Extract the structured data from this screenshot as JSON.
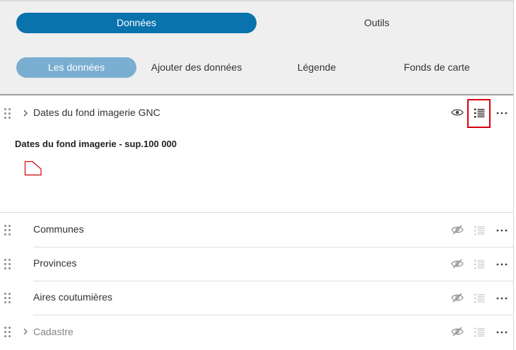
{
  "main_tabs": [
    {
      "label": "Données",
      "active": true
    },
    {
      "label": "Outils",
      "active": false
    }
  ],
  "sub_tabs": [
    {
      "label": "Les données",
      "active": true
    },
    {
      "label": "Ajouter des données",
      "active": false
    },
    {
      "label": "Légende",
      "active": false
    },
    {
      "label": "Fonds de carte",
      "active": false
    }
  ],
  "layers": [
    {
      "title": "Dates du fond imagerie GNC",
      "expandable": true,
      "visible": true,
      "legend_open": true,
      "legend": {
        "title": "Dates du fond imagerie - sup.100 000",
        "symbol_icon": "polygon-outline-icon",
        "symbol_color": "#d4000f"
      }
    },
    {
      "title": "Communes",
      "expandable": false,
      "visible": false
    },
    {
      "title": "Provinces",
      "expandable": false,
      "visible": false
    },
    {
      "title": "Aires coutumières",
      "expandable": false,
      "visible": false
    },
    {
      "title": "Cadastre",
      "expandable": true,
      "visible": false,
      "muted": true
    }
  ],
  "icons": {
    "drag": "drag-handle-icon",
    "expand": "chevron-right-icon",
    "visible": "eye-icon",
    "hidden": "eye-slash-icon",
    "legend": "legend-list-icon",
    "more": "more-dots-icon"
  },
  "colors": {
    "primary_tab": "#0a73ad",
    "secondary_tab": "#7aaed1",
    "highlight": "#d4000f"
  }
}
